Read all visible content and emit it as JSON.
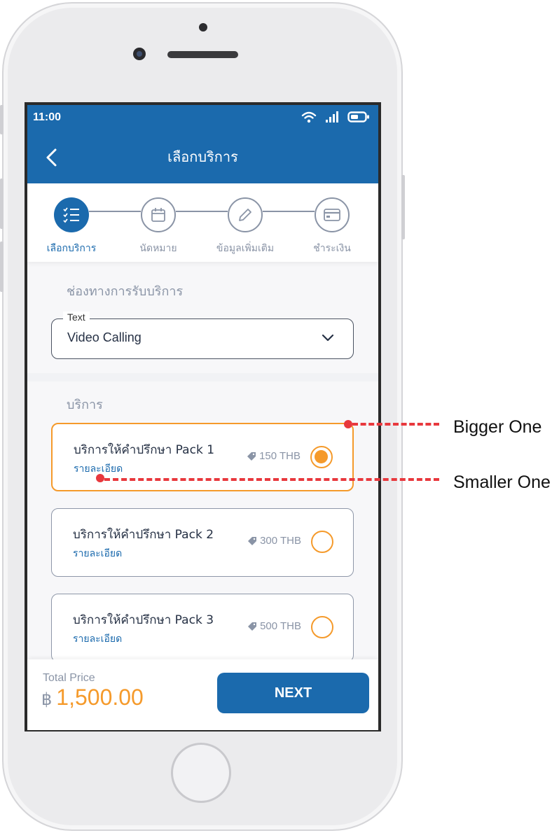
{
  "status_bar": {
    "time": "11:00"
  },
  "header": {
    "title": "เลือกบริการ"
  },
  "stepper": {
    "steps": [
      {
        "label": "เลือกบริการ",
        "icon": "checklist-icon",
        "active": true
      },
      {
        "label": "นัดหมาย",
        "icon": "calendar-icon",
        "active": false
      },
      {
        "label": "ข้อมูลเพิ่มเติม",
        "icon": "pencil-icon",
        "active": false
      },
      {
        "label": "ชำระเงิน",
        "icon": "credit-card-icon",
        "active": false
      }
    ]
  },
  "channel": {
    "section_label": "ช่องทางการรับบริการ",
    "field_label": "Text",
    "value": "Video Calling"
  },
  "services": {
    "section_label": "บริการ",
    "items": [
      {
        "title": "บริการให้คำปรึกษา Pack 1",
        "detail_link": "รายละเอียด",
        "price": "150 THB",
        "selected": true
      },
      {
        "title": "บริการให้คำปรึกษา Pack 2",
        "detail_link": "รายละเอียด",
        "price": "300 THB",
        "selected": false
      },
      {
        "title": "บริการให้คำปรึกษา Pack 3",
        "detail_link": "รายละเอียด",
        "price": "500 THB",
        "selected": false
      }
    ]
  },
  "footer": {
    "total_label": "Total Price",
    "currency_symbol": "฿",
    "total_amount": "1,500.00",
    "next_label": "NEXT"
  },
  "annotations": {
    "bigger": "Bigger One",
    "smaller": "Smaller One"
  },
  "colors": {
    "primary": "#1b6aad",
    "accent": "#f59a2b",
    "annotation": "#e8383d"
  }
}
